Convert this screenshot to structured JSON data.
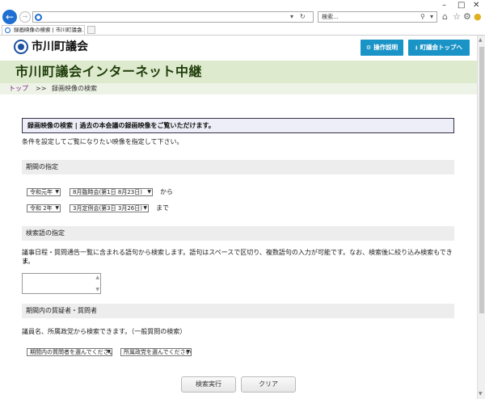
{
  "browser": {
    "search_placeholder": "検索...",
    "tab_title": "録画映像の検索 | 市川町議会..."
  },
  "site": {
    "name": "市川町議会",
    "btn_help": "操作説明",
    "btn_top": "町議会トップへ",
    "page_heading": "市川町議会インターネット中継"
  },
  "breadcrumb": {
    "home": "トップ",
    "separator": ">>",
    "current": "録画映像の検索"
  },
  "notice": "録画映像の検索 | 過去の本会議の録画映像をご覧いただけます。",
  "intro": "条件を設定してご覧になりたい映像を指定して下さい。",
  "period": {
    "heading": "期間の指定",
    "from_era": "令和元年",
    "from_session": "8月臨時会(第1日 8月23日)",
    "from_suffix": "から",
    "to_era": "令和 2年",
    "to_session": "3月定例会(第3日 3月26日)",
    "to_suffix": "まで"
  },
  "keyword": {
    "heading": "検索語の指定",
    "description": "議事日程・質問通告一覧に含まれる語句から検索します。語句はスペースで区切り、複数語句の入力が可能です。なお、検索後に絞り込み検索もできま",
    "description_cont": "す。"
  },
  "questioner": {
    "heading": "期間内の質疑者・質問者",
    "description": "議員名、所属政党から検索できます。（一般質問の検索）",
    "member_select": "期間内の質問者を選んでください",
    "party_select": "所属政党を選んでください"
  },
  "actions": {
    "search": "検索実行",
    "clear": "クリア"
  },
  "colors": {
    "accent_button": "#1a93c6",
    "title_band": "#deeacd",
    "breadcrumb_link": "#7b1a85"
  }
}
